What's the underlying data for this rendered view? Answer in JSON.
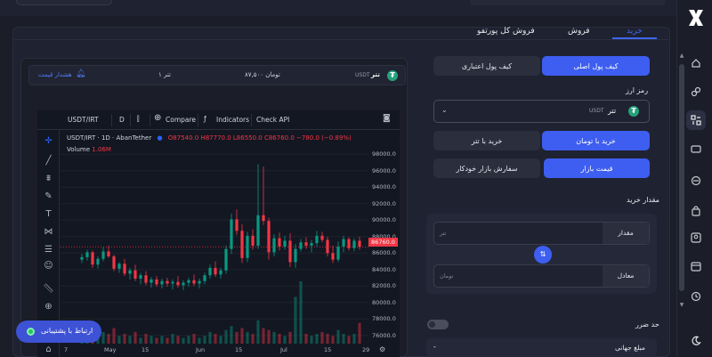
{
  "tabs": {
    "buy": "خرید",
    "sell": "فروش",
    "sell_all": "فروش کل پورتفو"
  },
  "info": {
    "coin_name": "تتر",
    "coin_code": "USDT",
    "price": "۸۷,۵۰۰ تومان",
    "amount": "۱ تتر",
    "price_alert": "هشدار قیمت"
  },
  "wallet": {
    "main": "کیف پول اصلی",
    "credit": "کیف پول اعتباری"
  },
  "currency": {
    "label": "رمز ارز",
    "selected_name": "تتر",
    "selected_code": "USDT"
  },
  "pair": {
    "toman": "خرید با تومان",
    "tether": "خرید با تتر"
  },
  "order": {
    "market": "قیمت بازار",
    "auto": "سفارش بازار خودکار"
  },
  "amount": {
    "label": "مقدار خرید",
    "qty_unit": "مقدار",
    "qty_placeholder": "تتر",
    "equiv_unit": "معادل",
    "equiv_placeholder": "تومان"
  },
  "stop_loss": {
    "label": "حد ضرر"
  },
  "global_price": {
    "label": "مبلغ جهانی",
    "value": "-"
  },
  "support": {
    "label": "ارتباط با پشتیبانی"
  },
  "tradingview": {
    "symbol": "USDT/IRT",
    "interval": "D",
    "compare": "Compare",
    "indicators": "Indicators",
    "check_api": "Check API",
    "legend_title": "USDT/IRT · 1D · AbanTether",
    "legend_values": "O87540.0  H87770.0  L86550.0  C86760.0  −780.0 (−0.89%)",
    "volume_label": "Volume",
    "volume_value": "1.06M",
    "last_price": "86760.0",
    "price_ticks": [
      "98000.0",
      "96000.0",
      "94000.0",
      "92000.0",
      "90000.0",
      "88000.0",
      "86000.0",
      "84000.0",
      "82000.0",
      "80000.0",
      "78000.0",
      "76000.0"
    ],
    "date_ticks": [
      "7",
      "May",
      "15",
      "Jun",
      "15",
      "Jul",
      "15",
      "29"
    ]
  },
  "chart_data": {
    "type": "candlestick",
    "ylim": [
      75000,
      99000
    ],
    "candles": [
      [
        85200,
        85900,
        84800,
        85500
      ],
      [
        85500,
        86400,
        85100,
        86100
      ],
      [
        86100,
        86300,
        84200,
        84600
      ],
      [
        84600,
        85600,
        84100,
        85300
      ],
      [
        85300,
        86700,
        85000,
        86200
      ],
      [
        86200,
        86900,
        85400,
        85600
      ],
      [
        85600,
        85800,
        83800,
        84100
      ],
      [
        84100,
        84900,
        83600,
        84700
      ],
      [
        84700,
        85300,
        83200,
        83500
      ],
      [
        83500,
        84200,
        82800,
        83900
      ],
      [
        83900,
        84600,
        82600,
        82900
      ],
      [
        82900,
        83600,
        82200,
        83300
      ],
      [
        83300,
        83800,
        82100,
        82400
      ],
      [
        82400,
        83100,
        81800,
        82800
      ],
      [
        82800,
        83200,
        81900,
        82200
      ],
      [
        82200,
        82900,
        81700,
        82600
      ],
      [
        82600,
        83000,
        81900,
        82300
      ],
      [
        82300,
        82800,
        81600,
        82500
      ],
      [
        82500,
        83200,
        81800,
        82100
      ],
      [
        82100,
        82700,
        81500,
        82400
      ],
      [
        82400,
        83000,
        81900,
        82700
      ],
      [
        82700,
        83400,
        82000,
        82300
      ],
      [
        82300,
        82900,
        81700,
        82600
      ],
      [
        82600,
        83600,
        82200,
        83300
      ],
      [
        83300,
        84600,
        82900,
        84200
      ],
      [
        84200,
        85000,
        83100,
        83400
      ],
      [
        83400,
        84200,
        82900,
        83900
      ],
      [
        83900,
        86900,
        83500,
        86500
      ],
      [
        86500,
        90800,
        85900,
        90100
      ],
      [
        90100,
        91300,
        88200,
        88700
      ],
      [
        88700,
        89500,
        84800,
        85400
      ],
      [
        85400,
        88600,
        84900,
        88100
      ],
      [
        88100,
        88900,
        86400,
        86900
      ],
      [
        86900,
        96800,
        86500,
        90600
      ],
      [
        90600,
        96500,
        89400,
        89900
      ],
      [
        89900,
        90300,
        85200,
        86100
      ],
      [
        86100,
        88300,
        85600,
        87800
      ],
      [
        87800,
        88500,
        86300,
        86800
      ],
      [
        86800,
        88100,
        86400,
        87500
      ],
      [
        87500,
        88400,
        84300,
        84900
      ],
      [
        84900,
        87100,
        84200,
        86500
      ],
      [
        86500,
        87700,
        86200,
        87300
      ],
      [
        87300,
        87900,
        86500,
        86900
      ],
      [
        86900,
        87600,
        86100,
        87200
      ],
      [
        87200,
        88700,
        86800,
        88100
      ],
      [
        88100,
        88600,
        87300,
        87600
      ],
      [
        87600,
        88000,
        85600,
        86000
      ],
      [
        86000,
        86900,
        84800,
        85200
      ],
      [
        85200,
        87400,
        84900,
        86800
      ],
      [
        86800,
        88100,
        86100,
        87700
      ],
      [
        87700,
        87900,
        86300,
        86600
      ],
      [
        86600,
        87800,
        86200,
        87500
      ],
      [
        87500,
        88000,
        86400,
        86760
      ]
    ],
    "volume": [
      0.6,
      0.5,
      0.7,
      0.4,
      0.6,
      0.5,
      0.8,
      0.4,
      0.5,
      0.4,
      0.6,
      0.3,
      0.5,
      0.4,
      0.3,
      0.4,
      0.3,
      0.5,
      0.4,
      0.3,
      0.4,
      0.5,
      0.3,
      0.4,
      0.6,
      0.5,
      0.4,
      0.7,
      0.9,
      0.6,
      0.8,
      0.6,
      0.5,
      1.2,
      0.8,
      0.7,
      0.6,
      0.5,
      0.4,
      0.6,
      2.4,
      3.2,
      0.5,
      0.4,
      0.5,
      0.6,
      0.5,
      0.4,
      0.7,
      0.5,
      0.4,
      0.5,
      1.06
    ]
  }
}
